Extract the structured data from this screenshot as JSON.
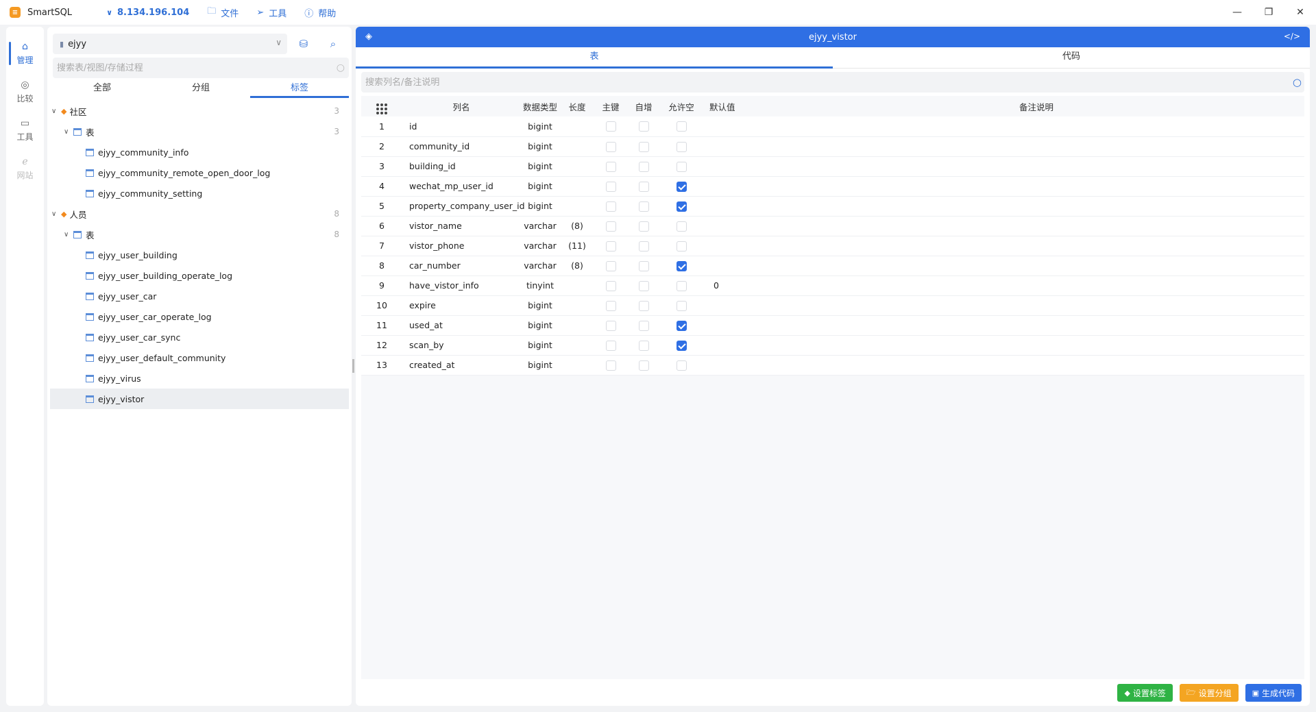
{
  "titlebar": {
    "app_name": "SmartSQL",
    "host": "8.134.196.104",
    "menu": [
      {
        "label": "文件",
        "icon": "folder-icon"
      },
      {
        "label": "工具",
        "icon": "send-icon"
      },
      {
        "label": "帮助",
        "icon": "info-icon"
      }
    ]
  },
  "nav": [
    {
      "label": "管理",
      "icon": "home-icon"
    },
    {
      "label": "比较",
      "icon": "compass-icon"
    },
    {
      "label": "工具",
      "icon": "inbox-icon"
    },
    {
      "label": "网站",
      "icon": "ie-icon"
    }
  ],
  "tree_panel": {
    "db_name": "ejyy",
    "search_placeholder": "搜索表/视图/存储过程",
    "tabs": [
      "全部",
      "分组",
      "标签"
    ],
    "groups": [
      {
        "label": "社区",
        "count": "3",
        "folder": {
          "label": "表",
          "count": "3"
        },
        "tables": [
          "ejyy_community_info",
          "ejyy_community_remote_open_door_log",
          "ejyy_community_setting"
        ]
      },
      {
        "label": "人员",
        "count": "8",
        "folder": {
          "label": "表",
          "count": "8"
        },
        "tables": [
          "ejyy_user_building",
          "ejyy_user_building_operate_log",
          "ejyy_user_car",
          "ejyy_user_car_operate_log",
          "ejyy_user_car_sync",
          "ejyy_user_default_community",
          "ejyy_virus",
          "ejyy_vistor"
        ]
      }
    ]
  },
  "main": {
    "title": "ejyy_vistor",
    "tabs": [
      "表",
      "代码"
    ],
    "search_placeholder": "搜索列名/备注说明",
    "columns": [
      "列名",
      "数据类型",
      "长度",
      "主键",
      "自增",
      "允许空",
      "默认值",
      "备注说明"
    ],
    "rows": [
      {
        "idx": "1",
        "name": "id",
        "type": "bigint",
        "len": "",
        "pk": false,
        "ai": false,
        "nullable": false,
        "def": "",
        "comment": ""
      },
      {
        "idx": "2",
        "name": "community_id",
        "type": "bigint",
        "len": "",
        "pk": false,
        "ai": false,
        "nullable": false,
        "def": "",
        "comment": ""
      },
      {
        "idx": "3",
        "name": "building_id",
        "type": "bigint",
        "len": "",
        "pk": false,
        "ai": false,
        "nullable": false,
        "def": "",
        "comment": ""
      },
      {
        "idx": "4",
        "name": "wechat_mp_user_id",
        "type": "bigint",
        "len": "",
        "pk": false,
        "ai": false,
        "nullable": true,
        "def": "",
        "comment": ""
      },
      {
        "idx": "5",
        "name": "property_company_user_id",
        "type": "bigint",
        "len": "",
        "pk": false,
        "ai": false,
        "nullable": true,
        "def": "",
        "comment": ""
      },
      {
        "idx": "6",
        "name": "vistor_name",
        "type": "varchar",
        "len": "(8)",
        "pk": false,
        "ai": false,
        "nullable": false,
        "def": "",
        "comment": ""
      },
      {
        "idx": "7",
        "name": "vistor_phone",
        "type": "varchar",
        "len": "(11)",
        "pk": false,
        "ai": false,
        "nullable": false,
        "def": "",
        "comment": ""
      },
      {
        "idx": "8",
        "name": "car_number",
        "type": "varchar",
        "len": "(8)",
        "pk": false,
        "ai": false,
        "nullable": true,
        "def": "",
        "comment": ""
      },
      {
        "idx": "9",
        "name": "have_vistor_info",
        "type": "tinyint",
        "len": "",
        "pk": false,
        "ai": false,
        "nullable": false,
        "def": "0",
        "comment": ""
      },
      {
        "idx": "10",
        "name": "expire",
        "type": "bigint",
        "len": "",
        "pk": false,
        "ai": false,
        "nullable": false,
        "def": "",
        "comment": ""
      },
      {
        "idx": "11",
        "name": "used_at",
        "type": "bigint",
        "len": "",
        "pk": false,
        "ai": false,
        "nullable": true,
        "def": "",
        "comment": ""
      },
      {
        "idx": "12",
        "name": "scan_by",
        "type": "bigint",
        "len": "",
        "pk": false,
        "ai": false,
        "nullable": true,
        "def": "",
        "comment": ""
      },
      {
        "idx": "13",
        "name": "created_at",
        "type": "bigint",
        "len": "",
        "pk": false,
        "ai": false,
        "nullable": false,
        "def": "",
        "comment": ""
      }
    ],
    "buttons": [
      {
        "label": "设置标签",
        "icon": "tags-icon",
        "color": "#2fb344"
      },
      {
        "label": "设置分组",
        "icon": "folder-open-icon",
        "color": "#f4a522"
      },
      {
        "label": "生成代码",
        "icon": "building-icon",
        "color": "#2f6fe4"
      }
    ]
  },
  "colors": {
    "accent": "#2f6fe4"
  }
}
